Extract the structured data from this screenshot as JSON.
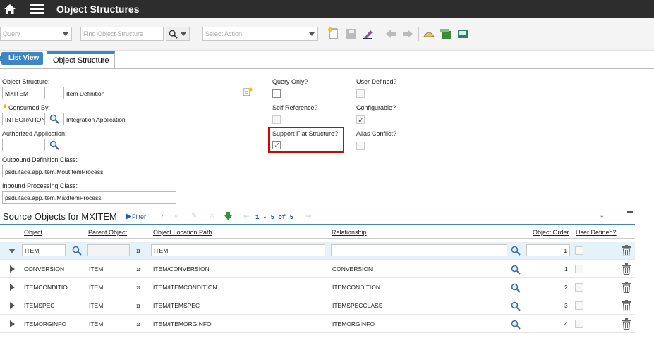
{
  "header": {
    "title": "Object Structures",
    "home_icon": "home-icon",
    "menu_icon": "hamburger-menu-icon"
  },
  "toolbar": {
    "query_placeholder": "Query",
    "find_placeholder": "Find Object Structure",
    "action_placeholder": "Select Action"
  },
  "tabs": {
    "list_view": "List View",
    "object_structure": "Object Structure"
  },
  "form": {
    "object_structure_label": "Object Structure:",
    "object_structure_value": "MXITEM",
    "description_value": "Item Definition",
    "consumed_by_label": "Consumed By:",
    "consumed_by_value": "INTEGRATION",
    "consumed_by_desc": "Integration Application",
    "authorized_app_label": "Authorized Application:",
    "authorized_app_value": "",
    "outbound_label": "Outbound Definition Class:",
    "outbound_value": "psdi.iface.app.item.MoutItemProcess",
    "inbound_label": "Inbound Processing Class:",
    "inbound_value": "psdi.iface.app.item.MaxItemProcess",
    "query_only_label": "Query Only?",
    "user_defined_label": "User Defined?",
    "self_reference_label": "Self Reference?",
    "configurable_label": "Configurable?",
    "support_flat_label": "Support Flat Structure?",
    "alias_conflict_label": "Alias Conflict?"
  },
  "source": {
    "title": "Source Objects for MXITEM",
    "filter_label": "Filter",
    "pager_text": "1 - 5 of 5",
    "columns": [
      "Object",
      "Parent Object",
      "Object Location Path",
      "Relationship",
      "Object Order",
      "User Defined?"
    ],
    "rows": [
      {
        "object": "ITEM",
        "parent": "",
        "path": "ITEM",
        "relationship": "",
        "order": "1"
      },
      {
        "object": "CONVERSION",
        "parent": "ITEM",
        "path": "ITEM/CONVERSION",
        "relationship": "CONVERSION",
        "order": "1"
      },
      {
        "object": "ITEMCONDITIO",
        "parent": "ITEM",
        "path": "ITEM/ITEMCONDITION",
        "relationship": "ITEMCONDITION",
        "order": "2"
      },
      {
        "object": "ITEMSPEC",
        "parent": "ITEM",
        "path": "ITEM/ITEMSPEC",
        "relationship": "ITEMSPECCLASS",
        "order": "3"
      },
      {
        "object": "ITEMORGINFO",
        "parent": "ITEM",
        "path": "ITEM/ITEMORGINFO",
        "relationship": "ITEMORGINFO",
        "order": "4"
      }
    ]
  }
}
